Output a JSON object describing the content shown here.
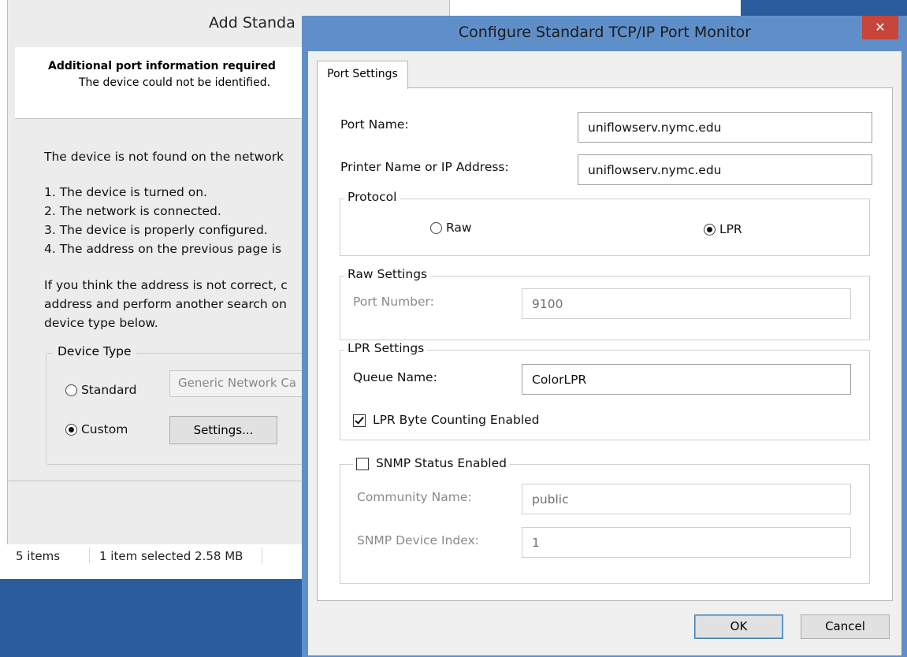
{
  "explorer": {
    "status_items": "5 items",
    "status_selected": "1 item selected  2.58 MB"
  },
  "wizard": {
    "title": "Add Standa",
    "header_title": "Additional port information required",
    "header_sub": "The device could not be identified.",
    "intro": "The device is not found on the network",
    "list": [
      "1.  The device is turned on.",
      "2.  The network is connected.",
      "3.  The device is properly configured.",
      "4.  The address on the previous page is"
    ],
    "para": [
      "If you think the address is not correct, c",
      "address and perform another search on",
      "device type below."
    ],
    "device_type_legend": "Device Type",
    "standard_label": "Standard",
    "custom_label": "Custom",
    "standard_combo": "Generic Network Ca",
    "settings_button": "Settings..."
  },
  "dialog": {
    "title": "Configure Standard TCP/IP Port Monitor",
    "close_symbol": "✕",
    "tab": "Port Settings",
    "port_name_label": "Port Name:",
    "port_name_value": "uniflowserv.nymc.edu",
    "printer_label": "Printer Name or IP Address:",
    "printer_value": "uniflowserv.nymc.edu",
    "protocol_legend": "Protocol",
    "raw_label": "Raw",
    "lpr_label": "LPR",
    "protocol_selected": "LPR",
    "raw_settings_legend": "Raw Settings",
    "port_number_label": "Port Number:",
    "port_number_value": "9100",
    "lpr_settings_legend": "LPR Settings",
    "queue_name_label": "Queue Name:",
    "queue_name_value": "ColorLPR",
    "byte_counting_label": "LPR Byte Counting Enabled",
    "byte_counting_checked": true,
    "snmp_label": "SNMP Status Enabled",
    "snmp_checked": false,
    "community_label": "Community Name:",
    "community_value": "public",
    "snmp_index_label": "SNMP Device Index:",
    "snmp_index_value": "1",
    "ok_button": "OK",
    "cancel_button": "Cancel"
  },
  "colors": {
    "desktop": "#2b5d9e",
    "dialog_frame": "#5f8fc9",
    "close_button": "#c7453a"
  }
}
